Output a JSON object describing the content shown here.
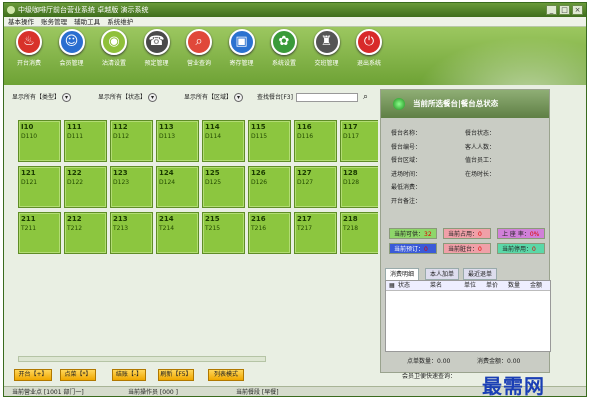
{
  "window": {
    "title": "中级咖啡厅前台营业系统 卓越版 演示系统"
  },
  "menu": [
    "基本操作",
    "账务管理",
    "辅助工具",
    "系统维护"
  ],
  "toolbar": [
    {
      "label": "开台消费",
      "icon": "bell-icon",
      "color": "#d8322a"
    },
    {
      "label": "会员管理",
      "icon": "user-icon",
      "color": "#2a6ed0"
    },
    {
      "label": "沽清设置",
      "icon": "plate-icon",
      "color": "#8fc03a"
    },
    {
      "label": "预定管理",
      "icon": "phone-icon",
      "color": "#4a4a4a"
    },
    {
      "label": "营业查询",
      "icon": "search-icon",
      "color": "#e0483a"
    },
    {
      "label": "寄存管理",
      "icon": "bag-icon",
      "color": "#2a72d0"
    },
    {
      "label": "系统设置",
      "icon": "gear-icon",
      "color": "#3a9a3a"
    },
    {
      "label": "交班管理",
      "icon": "handover-icon",
      "color": "#555555"
    },
    {
      "label": "退出系统",
      "icon": "power-icon",
      "color": "#d82a2a"
    }
  ],
  "filters": {
    "type": "显示所有【类型】",
    "status": "显示所有【状态】",
    "area": "显示所有【区域】",
    "search_label": "查找餐台[F3]"
  },
  "tables": [
    {
      "num": "I10",
      "code": "D110"
    },
    {
      "num": "111",
      "code": "D111"
    },
    {
      "num": "112",
      "code": "D112"
    },
    {
      "num": "113",
      "code": "D113"
    },
    {
      "num": "114",
      "code": "D114"
    },
    {
      "num": "115",
      "code": "D115"
    },
    {
      "num": "116",
      "code": "D116"
    },
    {
      "num": "117",
      "code": "D117"
    },
    {
      "num": "121",
      "code": "D121"
    },
    {
      "num": "122",
      "code": "D122"
    },
    {
      "num": "123",
      "code": "D123"
    },
    {
      "num": "124",
      "code": "D124"
    },
    {
      "num": "125",
      "code": "D125"
    },
    {
      "num": "126",
      "code": "D126"
    },
    {
      "num": "127",
      "code": "D127"
    },
    {
      "num": "128",
      "code": "D128"
    },
    {
      "num": "211",
      "code": "T211"
    },
    {
      "num": "212",
      "code": "T212"
    },
    {
      "num": "213",
      "code": "T213"
    },
    {
      "num": "214",
      "code": "T214"
    },
    {
      "num": "215",
      "code": "T215"
    },
    {
      "num": "216",
      "code": "T216"
    },
    {
      "num": "217",
      "code": "T217"
    },
    {
      "num": "218",
      "code": "T218"
    }
  ],
  "panel": {
    "title": "当前所选餐台|餐台总状态",
    "fields_left": [
      "餐台名称：",
      "餐台编号：",
      "餐台区域：",
      "进场时间：",
      "最低消费：",
      "开台备注："
    ],
    "fields_right": [
      "餐台状态：",
      "客人人数：",
      "值台员工：",
      "在场时长："
    ],
    "stats": [
      {
        "label": "当前可供：",
        "value": "32",
        "color": "#8ed66a"
      },
      {
        "label": "当前占用：",
        "value": "0",
        "color": "#f0a0a8"
      },
      {
        "label": "上 座 率：",
        "value": "0%",
        "color": "#d080d8"
      },
      {
        "label": "当前预订：",
        "value": "0",
        "color": "#3a5ad8"
      },
      {
        "label": "当前脏台：",
        "value": "0",
        "color": "#f0a0a8"
      },
      {
        "label": "当前停用：",
        "value": "0",
        "color": "#5ad8a8"
      }
    ],
    "tabs": [
      "消费明细",
      "本人加单",
      "最近退单"
    ],
    "columns": [
      "状态",
      "菜名",
      "单位",
      "单价",
      "数量",
      "金额"
    ],
    "qty_label": "点单数量：0.00",
    "amount_label": "消费金额：0.00"
  },
  "buttons": [
    "开台【+】",
    "点菜【*】",
    "结账【-】",
    "刷新【F5】",
    "列表模式"
  ],
  "member_query": "会员卫便快速查询：",
  "status": {
    "point": "当前营业点 [1001 部门一]",
    "operator": "当前操作员 [000 ]",
    "period": "当前餐段 [早餐]"
  },
  "watermark": "最需网"
}
